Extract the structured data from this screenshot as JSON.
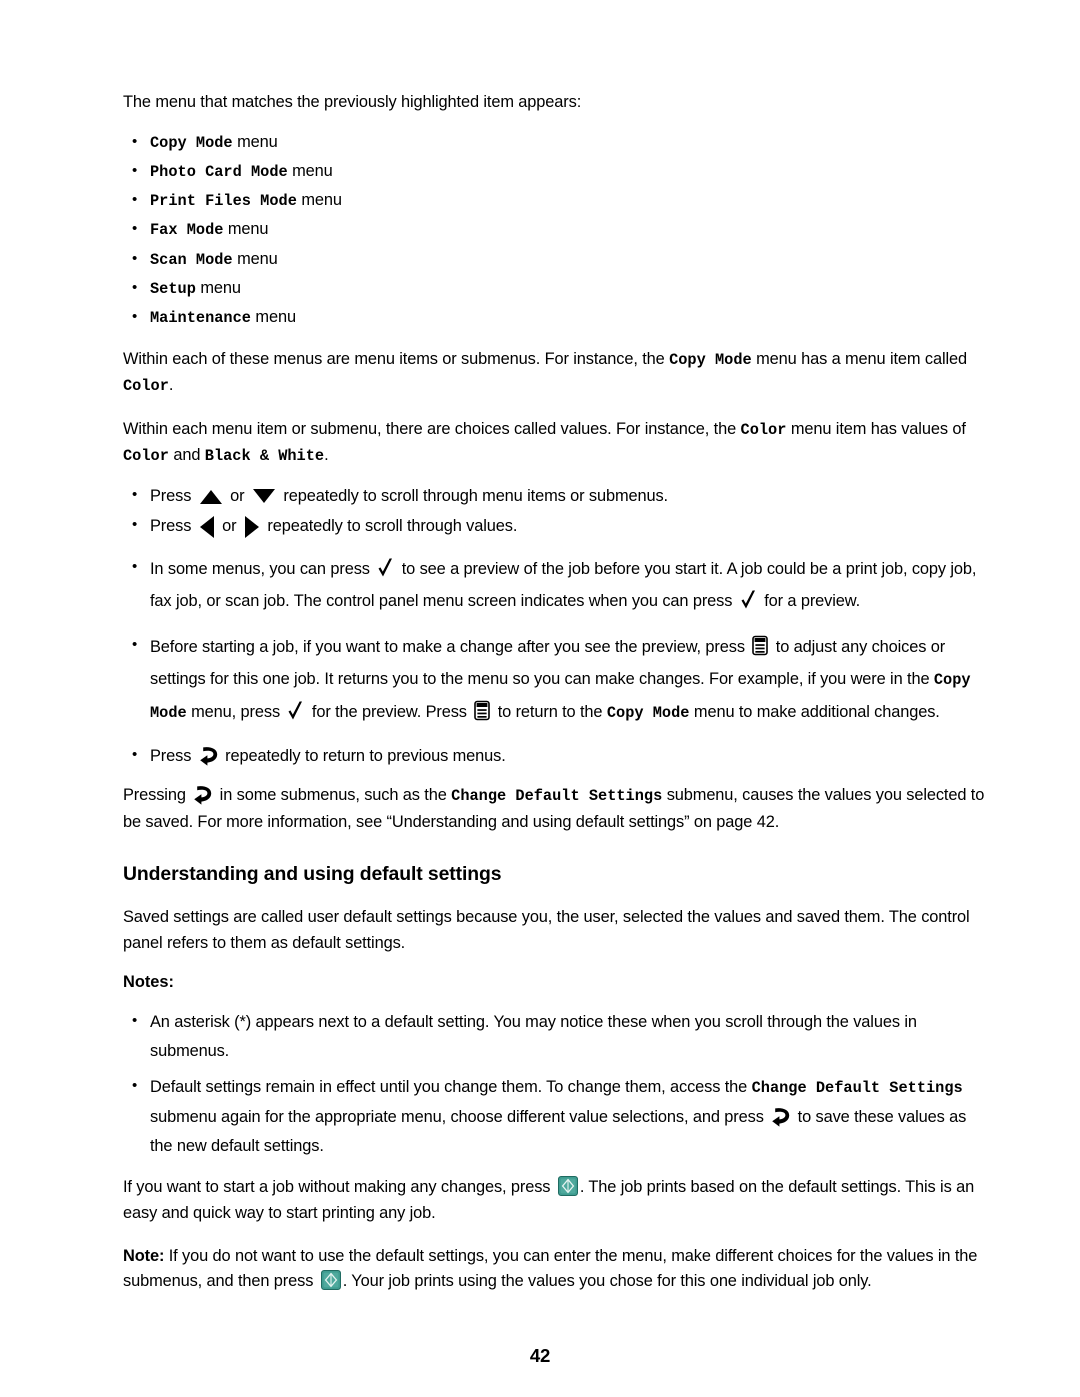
{
  "document": {
    "page_number": "42",
    "intro_line": "The menu that matches the previously highlighted item appears:",
    "menu_list": [
      {
        "name": "Copy Mode",
        "suffix": "menu"
      },
      {
        "name": "Photo Card Mode",
        "suffix": "menu"
      },
      {
        "name": "Print Files Mode",
        "suffix": "menu"
      },
      {
        "name": "Fax Mode",
        "suffix": "menu"
      },
      {
        "name": "Scan Mode",
        "suffix": "menu"
      },
      {
        "name": "Setup",
        "suffix": "menu"
      },
      {
        "name": "Maintenance",
        "suffix": "menu"
      }
    ],
    "para_menu_items": {
      "part1": "Within each of these menus are menu items or submenus. For instance, the ",
      "mono1": "Copy Mode",
      "part2": " menu has a menu item called ",
      "mono2": "Color",
      "part3": "."
    },
    "para_values": {
      "part1": "Within each menu item or submenu, there are choices called values. For instance, the ",
      "mono1": "Color",
      "part2": " menu item has values of ",
      "mono2": "Color",
      "part3": " and ",
      "mono3": "Black & White",
      "part4": "."
    },
    "press_bullets": {
      "scroll_items": {
        "part1": "Press ",
        "icon1": "triangle-up-icon",
        "part2": " or ",
        "icon2": "triangle-down-icon",
        "part3": " repeatedly to scroll through menu items or submenus."
      },
      "scroll_values": {
        "part1": "Press ",
        "icon1": "triangle-left-icon",
        "part2": " or ",
        "icon2": "triangle-right-icon",
        "part3": " repeatedly to scroll through values."
      }
    },
    "preview_bullet": {
      "part1": "In some menus, you can press ",
      "icon1": "checkmark-icon",
      "part2": " to see a preview of the job before you start it. A job could be a print job, copy job, fax job, or scan job. The control panel menu screen indicates when you can press ",
      "icon2": "checkmark-icon",
      "part3": " for a preview."
    },
    "change_bullet": {
      "part1": "Before starting a job, if you want to make a change after you see the preview, press ",
      "icon1": "menu-button-icon",
      "part2": " to adjust any choices or settings for this one job. It returns you to the menu so you can make changes. For example, if you were in the ",
      "mono1": "Copy Mode",
      "part3": " menu, press ",
      "icon2": "checkmark-icon",
      "part4": " for the preview. Press ",
      "icon3": "menu-button-icon",
      "part5": " to return to the ",
      "mono2": "Copy Mode",
      "part6": " menu to make additional changes."
    },
    "back_bullet": {
      "part1": "Press ",
      "icon1": "back-arrow-icon",
      "part2": " repeatedly to return to previous menus."
    },
    "pressing_para": {
      "part1": "Pressing ",
      "icon1": "back-arrow-icon",
      "part2": " in some submenus, such as the ",
      "mono1": "Change Default Settings",
      "part3": " submenu, causes the values you selected to be saved. For more information, see “Understanding and using default settings” on page 42."
    },
    "section_heading": "Understanding and using default settings",
    "saved_settings_para": "Saved settings are called user default settings because you, the user, selected the values and saved them. The control panel refers to them as default settings.",
    "notes_label": "Notes:",
    "notes": {
      "asterisk": "An asterisk (*) appears next to a default setting. You may notice these when you scroll through the values in submenus.",
      "default_remain": {
        "part1": "Default settings remain in effect until you change them. To change them, access the ",
        "mono1": "Change Default Settings",
        "part2": " submenu again for the appropriate menu, choose different value selections, and press ",
        "icon1": "back-arrow-icon",
        "part3": " to save these values as the new default settings."
      }
    },
    "start_job_para": {
      "part1": "If you want to start a job without making any changes, press ",
      "icon1": "start-button-icon",
      "part2": ". The job prints based on the default settings. This is an easy and quick way to start printing any job."
    },
    "final_note": {
      "label": "Note:",
      "part1": " If you do not want to use the default settings, you can enter the menu, make different choices for the values in the submenus, and then press ",
      "icon1": "start-button-icon",
      "part2": ". Your job prints using the values you chose for this one individual job only."
    }
  },
  "colors": {
    "text": "#000000",
    "page_background": "#ffffff",
    "start_button_teal": "#3f9c90",
    "start_button_inner": "#6fc0b4"
  }
}
